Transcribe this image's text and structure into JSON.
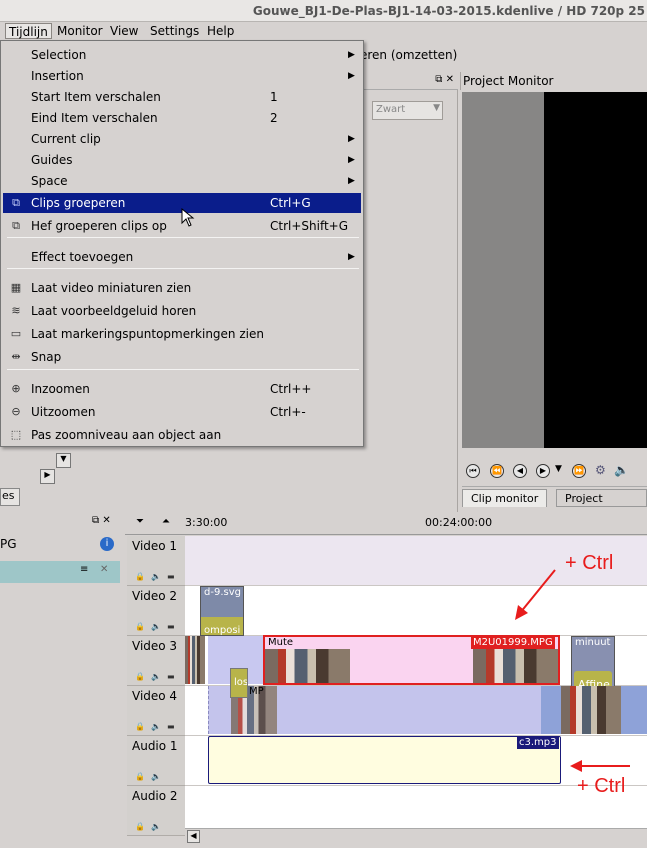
{
  "window": {
    "title": "Gouwe_BJ1-De-Plas-BJ1-14-03-2015.kdenlive / HD 720p 25"
  },
  "menubar": {
    "items": [
      "Tijdlijn",
      "Monitor",
      "View",
      "Settings",
      "Help"
    ]
  },
  "toolbar": {
    "partial_text": "eren (omzetten)"
  },
  "effect": {
    "color_select": "Zwart"
  },
  "project_monitor": {
    "title": "Project Monitor",
    "tabs": [
      "Clip monitor",
      "Project Monitor"
    ]
  },
  "project_panel": {
    "file_partial": "PG",
    "tab_partial": "es"
  },
  "timeline": {
    "ruler": [
      "3:30:00",
      "00:24:00:00"
    ],
    "tracks": [
      "Video 1",
      "Video 2",
      "Video 3",
      "Video 4",
      "Audio 1",
      "Audio 2"
    ],
    "clips": {
      "svg": "d-9.svg",
      "composite": "omposi",
      "mute": "Mute",
      "m2u": "M2U01999.MPG",
      "minuut": "minuut",
      "affine": "Affine",
      "mp_partial": "MP",
      "los": "los",
      "c3": "c3.mp3"
    }
  },
  "menu": {
    "items": [
      {
        "label": "Selection",
        "shortcut": "",
        "submenu": true,
        "icon": ""
      },
      {
        "label": "Insertion",
        "shortcut": "",
        "submenu": true,
        "icon": ""
      },
      {
        "label": "Start Item verschalen",
        "shortcut": "1",
        "submenu": false,
        "icon": ""
      },
      {
        "label": "Eind Item verschalen",
        "shortcut": "2",
        "submenu": false,
        "icon": ""
      },
      {
        "label": "Current clip",
        "shortcut": "",
        "submenu": true,
        "icon": ""
      },
      {
        "label": "Guides",
        "shortcut": "",
        "submenu": true,
        "icon": ""
      },
      {
        "label": "Space",
        "shortcut": "",
        "submenu": true,
        "icon": ""
      },
      {
        "label": "Clips groeperen",
        "shortcut": "Ctrl+G",
        "submenu": false,
        "icon": "group-icon"
      },
      {
        "label": "Hef groeperen clips op",
        "shortcut": "Ctrl+Shift+G",
        "submenu": false,
        "icon": "ungroup-icon"
      },
      {
        "label": "Effect toevoegen",
        "shortcut": "",
        "submenu": true,
        "icon": ""
      },
      {
        "label": "Laat video miniaturen zien",
        "shortcut": "",
        "submenu": false,
        "icon": "film-thumbnail-icon"
      },
      {
        "label": "Laat voorbeeldgeluid horen",
        "shortcut": "",
        "submenu": false,
        "icon": "audio-wave-icon"
      },
      {
        "label": "Laat markeringspuntopmerkingen zien",
        "shortcut": "",
        "submenu": false,
        "icon": "marker-icon"
      },
      {
        "label": "Snap",
        "shortcut": "",
        "submenu": false,
        "icon": "snap-icon"
      },
      {
        "label": "Inzoomen",
        "shortcut": "Ctrl++",
        "submenu": false,
        "icon": "zoom-in-icon"
      },
      {
        "label": "Uitzoomen",
        "shortcut": "Ctrl+-",
        "submenu": false,
        "icon": "zoom-out-icon"
      },
      {
        "label": "Pas zoomniveau aan object aan",
        "shortcut": "",
        "submenu": false,
        "icon": "zoom-fit-icon"
      }
    ]
  },
  "annotations": {
    "top": "+ Ctrl",
    "bottom": "+ Ctrl"
  },
  "colors": {
    "highlight": "#0a1d8b",
    "selection_clip_border": "#e02020",
    "annotation": "#e81c1c"
  }
}
